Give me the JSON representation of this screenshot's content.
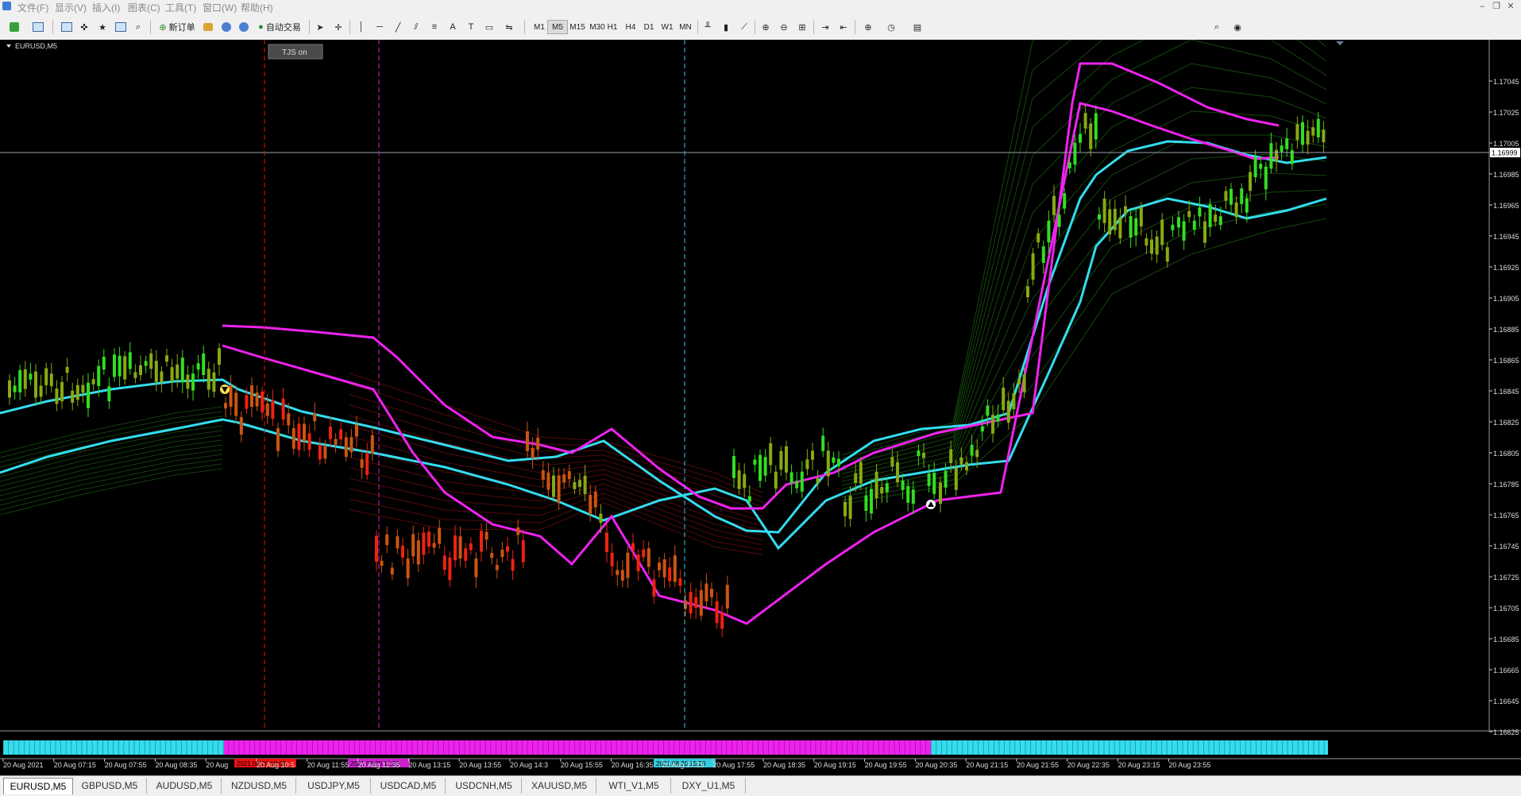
{
  "menu": [
    "文件(F)",
    "显示(V)",
    "插入(I)",
    "图表(C)",
    "工具(T)",
    "窗口(W)",
    "帮助(H)"
  ],
  "toolbar": {
    "new_order_label": "新订单",
    "autotrade_label": "自动交易",
    "timeframes": [
      "M1",
      "M5",
      "M15",
      "M30",
      "H1",
      "H4",
      "D1",
      "W1",
      "MN"
    ],
    "active_timeframe": "M5"
  },
  "chart": {
    "symbol_label": "EURUSD,M5",
    "tjs_button": "TJS on",
    "current_price": "1.16999",
    "price_ticks": [
      "1.17045",
      "1.17025",
      "1.17005",
      "1.16985",
      "1.16965",
      "1.16945",
      "1.16925",
      "1.16905",
      "1.16885",
      "1.16865",
      "1.16845",
      "1.16825",
      "1.16805",
      "1.16785",
      "1.16765",
      "1.16745",
      "1.16725",
      "1.16705",
      "1.16685",
      "1.16665",
      "1.16645",
      "1.16625"
    ],
    "time_ticks": [
      "20 Aug 2021",
      "20 Aug 07:15",
      "20 Aug 07:55",
      "20 Aug 08:35",
      "20 Aug",
      "20 Aug 10:5",
      "20 Aug 11:55",
      "20 Aug 12:35",
      "20 Aug 13:15",
      "20 Aug 13:55",
      "20 Aug 14:3",
      "20 Aug 15:55",
      "20 Aug 16:35",
      "20 Aug 17:15",
      "20 Aug 17:55",
      "20 Aug 18:35",
      "20 Aug 19:15",
      "20 Aug 19:55",
      "20 Aug 20:35",
      "20 Aug 21:15",
      "20 Aug 21:55",
      "20 Aug 22:35",
      "20 Aug 23:15",
      "20 Aug 23:55"
    ],
    "vline_labels": [
      "2021.08.20 10:05",
      "2021.08.20 11:30",
      "2021.08.20 15:20"
    ],
    "colors": {
      "bull": "#33dd22",
      "bull_dim": "#88aa11",
      "bear": "#ee2211",
      "bear_dim": "#cc5511",
      "cyan": "#33ddee",
      "magenta": "#ee22ee",
      "ribbon_green": "#1f7a12",
      "ribbon_red": "#8a1010"
    }
  },
  "tabs": [
    "EURUSD,M5",
    "GBPUSD,M5",
    "AUDUSD,M5",
    "NZDUSD,M5",
    "USDJPY,M5",
    "USDCAD,M5",
    "USDCNH,M5",
    "XAUUSD,M5",
    "WTI_V1,M5",
    "DXY_U1,M5"
  ],
  "active_tab": "EURUSD,M5"
}
